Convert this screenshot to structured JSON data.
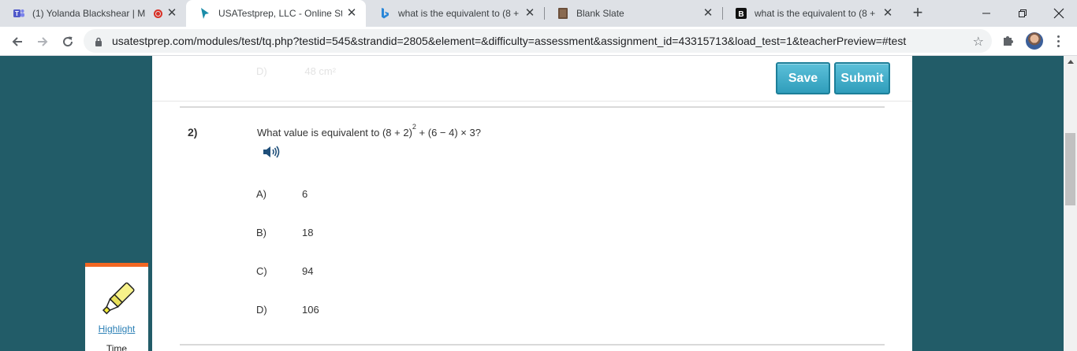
{
  "browser": {
    "tabs": [
      {
        "title": "(1) Yolanda Blackshear | M",
        "icon": "teams-icon",
        "active": false
      },
      {
        "title": "USATestprep, LLC - Online Stat",
        "icon": "cursor-arrow-icon",
        "active": true
      },
      {
        "title": "what is the equivalent to (8 + 2",
        "icon": "bing-icon",
        "active": false
      },
      {
        "title": "Blank Slate",
        "icon": "blank-slate-icon",
        "active": false
      },
      {
        "title": "what is the equivalent to (8 + 2",
        "icon": "brainly-icon",
        "active": false
      }
    ],
    "url": "usatestprep.com/modules/test/tq.php?testid=545&strandid=2805&element=&difficulty=assessment&assignment_id=43315713&load_test=1&teacherPreview=#test"
  },
  "page": {
    "previous_answer": {
      "letter": "D)",
      "value": "48 cm²"
    },
    "buttons": {
      "save": "Save",
      "submit": "Submit"
    },
    "question": {
      "number": "2)",
      "text_before": "What value is equivalent to (8 + 2)",
      "superscript": "2",
      "text_after": " + (6 − 4) × 3?"
    },
    "choices": [
      {
        "letter": "A)",
        "value": "6"
      },
      {
        "letter": "B)",
        "value": "18"
      },
      {
        "letter": "C)",
        "value": "94"
      },
      {
        "letter": "D)",
        "value": "106"
      }
    ],
    "tools": {
      "highlight": "Highlight",
      "time": "Time"
    }
  },
  "colors": {
    "page_bg": "#225c68",
    "accent_orange": "#f26722",
    "button_blue": "#2f9dbb"
  }
}
